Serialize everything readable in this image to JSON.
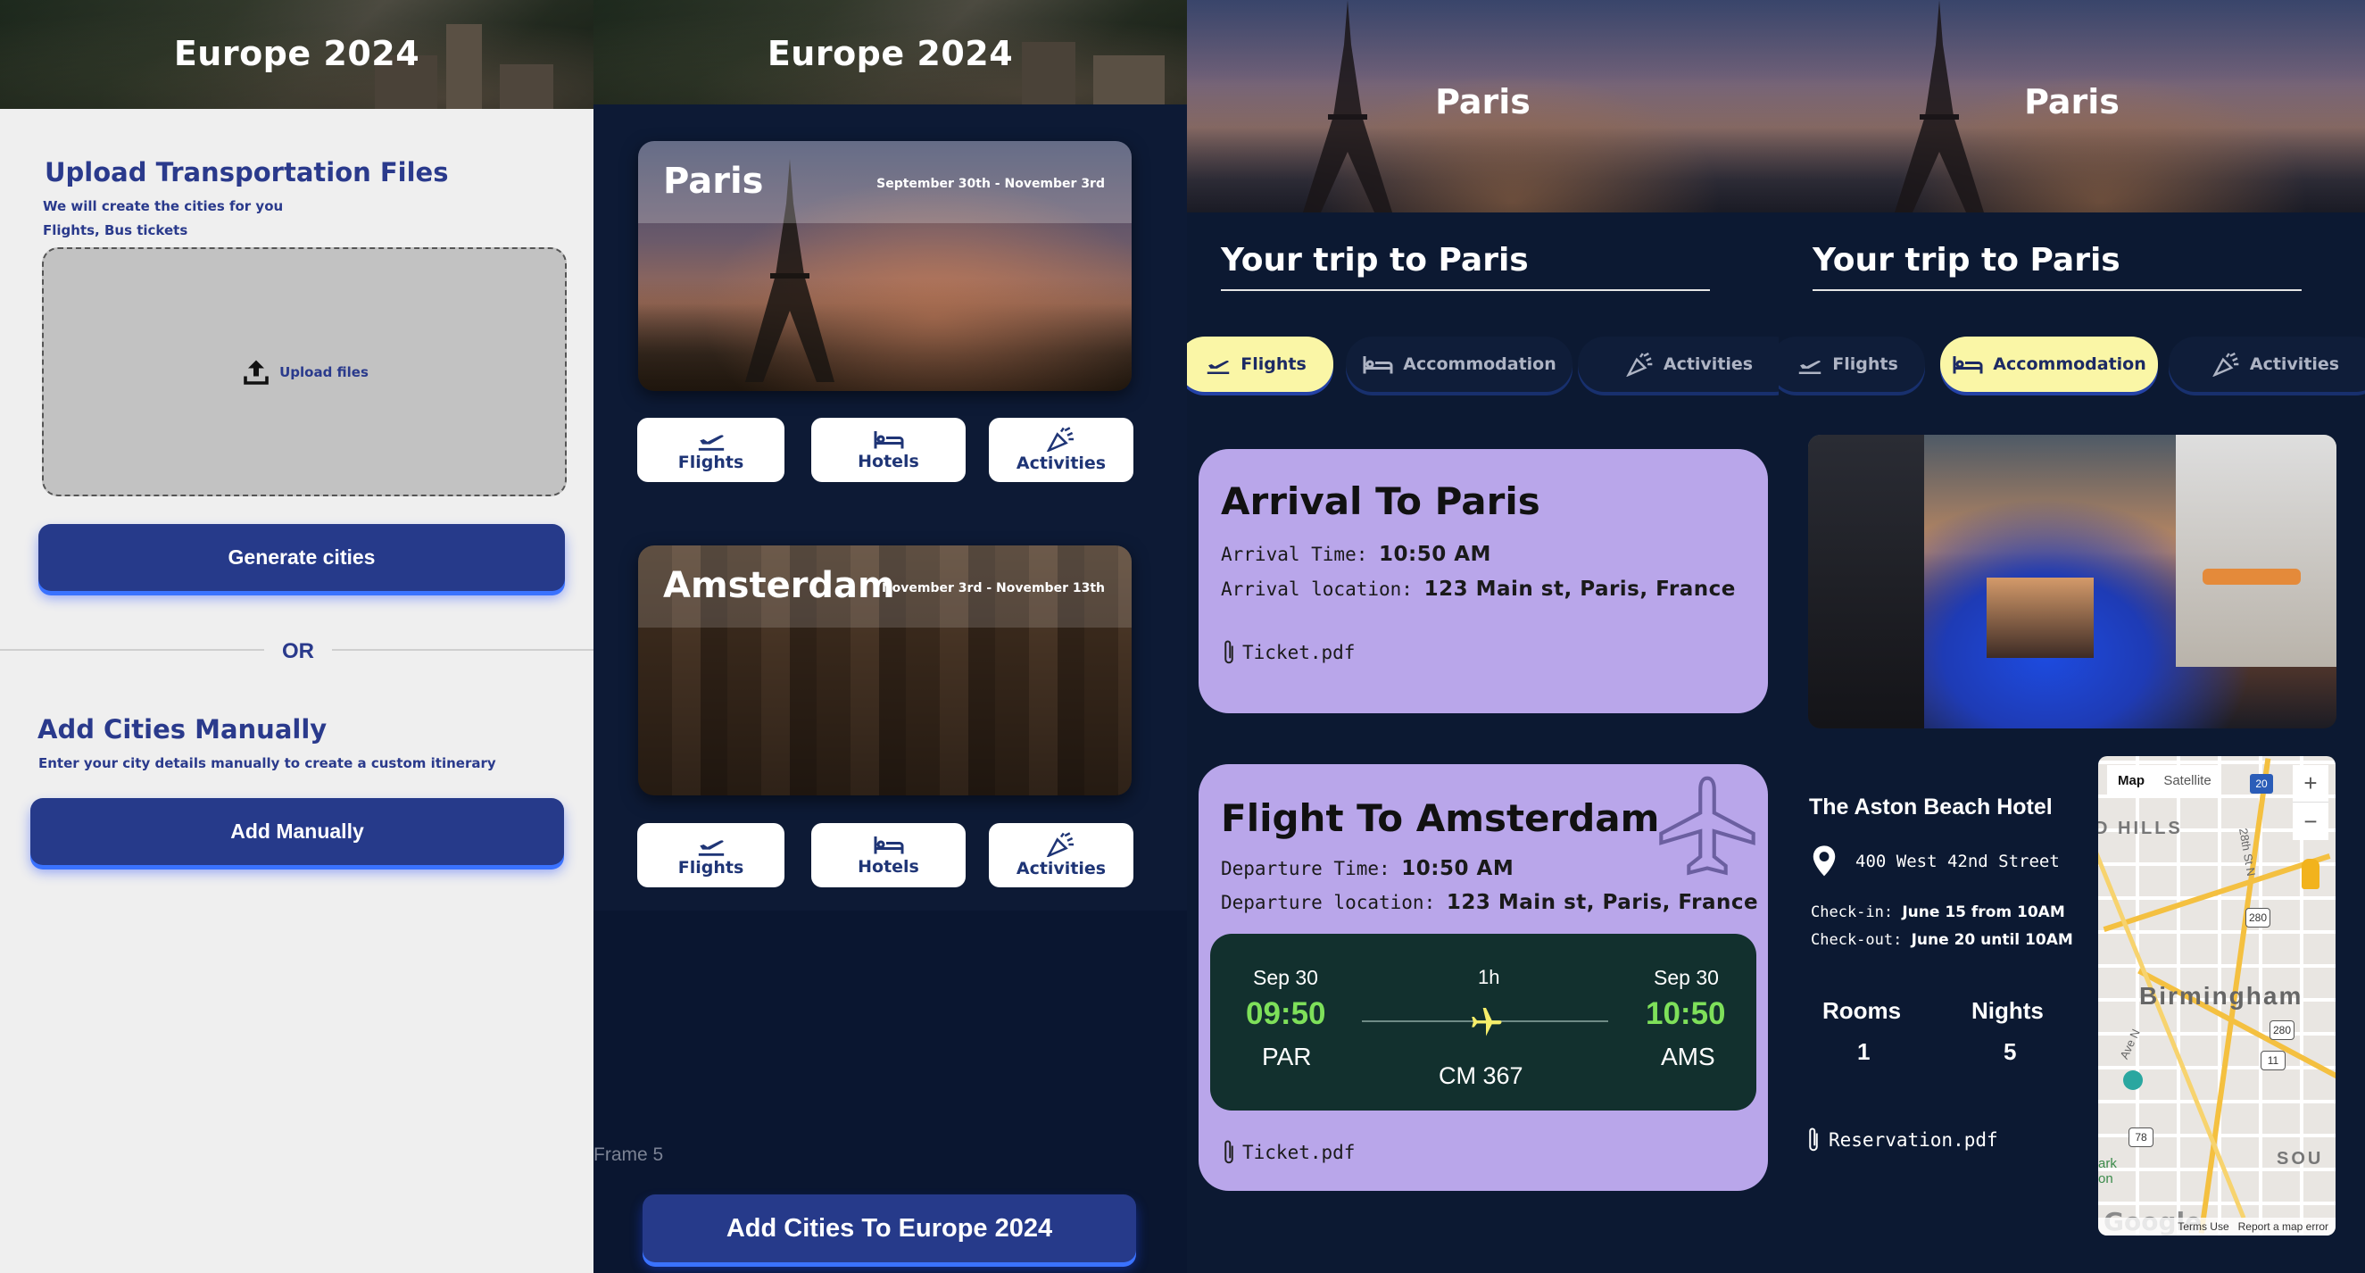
{
  "panel1": {
    "header_title": "Europe 2024",
    "upload_heading": "Upload Transportation Files",
    "upload_sub1": "We will create the cities for you",
    "upload_sub2": "Flights, Bus tickets",
    "upload_label": "Upload files",
    "generate_button": "Generate cities",
    "or_text": "OR",
    "manual_heading": "Add Cities Manually",
    "manual_sub": "Enter your city details manually to create a custom itinerary",
    "manual_button": "Add Manually"
  },
  "panel2": {
    "header_title": "Europe 2024",
    "cities": [
      {
        "name": "Paris",
        "dates": "September 30th - November 3rd"
      },
      {
        "name": "Amsterdam",
        "dates": "November 3rd - November 13th"
      }
    ],
    "tiles": {
      "flights": "Flights",
      "hotels": "Hotels",
      "activities": "Activities"
    },
    "frame_label": "Frame 5",
    "add_cities_button": "Add Cities To Europe 2024"
  },
  "panel3": {
    "hero_title": "Paris",
    "trip_title": "Your trip to Paris",
    "tabs": {
      "flights": "Flights",
      "accommodation": "Accommodation",
      "activities": "Activities"
    },
    "arrival": {
      "title": "Arrival To Paris",
      "time_label": "Arrival Time: ",
      "time_value": "10:50 AM",
      "location_label": "Arrival location: ",
      "location_value": "123 Main st, Paris, France",
      "attachment": "Ticket.pdf"
    },
    "flight": {
      "title": "Flight To Amsterdam",
      "time_label": "Departure Time: ",
      "time_value": "10:50 AM",
      "location_label": "Departure location: ",
      "location_value": "123 Main st, Paris, France",
      "dep_date": "Sep 30",
      "dep_time": "09:50",
      "dep_code": "PAR",
      "duration": "1h",
      "flight_no": "CM 367",
      "arr_date": "Sep 30",
      "arr_time": "10:50",
      "arr_code": "AMS",
      "attachment": "Ticket.pdf"
    }
  },
  "panel4": {
    "hero_title": "Paris",
    "trip_title": "Your trip to Paris",
    "tabs": {
      "flights": "Flights",
      "accommodation": "Accommodation",
      "activities": "Activities"
    },
    "hotel_name": "The Aston Beach Hotel",
    "address": "400 West 42nd Street",
    "checkin_label": "Check-in: ",
    "checkin_value": "June 15 from 10AM",
    "checkout_label": "Check-out: ",
    "checkout_value": "June 20 until 10AM",
    "rooms_label": "Rooms",
    "rooms_value": "1",
    "nights_label": "Nights",
    "nights_value": "5",
    "attachment": "Reservation.pdf",
    "map": {
      "tab_map": "Map",
      "tab_satellite": "Satellite",
      "city_label": "Birmingham",
      "area_label": "D HILLS",
      "south_label": "SOU",
      "street1": "28th St N",
      "street2": "Ave N",
      "zoom_in": "+",
      "zoom_out": "−",
      "shields": [
        "20",
        "280",
        "280",
        "11",
        "78"
      ],
      "footer_terms": "Terms  Use",
      "footer_report": "Report a map error",
      "google": "Google",
      "park_text": "ark on"
    }
  }
}
